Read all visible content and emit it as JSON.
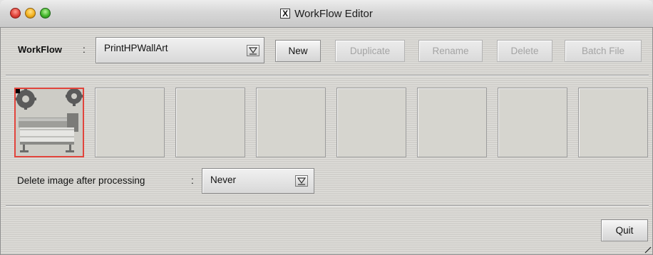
{
  "window": {
    "title": "WorkFlow Editor"
  },
  "workflow": {
    "label": "WorkFlow",
    "colon": ":",
    "selected": "PrintHPWallArt"
  },
  "buttons": {
    "new": "New",
    "duplicate": "Duplicate",
    "rename": "Rename",
    "delete": "Delete",
    "batch_file": "Batch File",
    "quit": "Quit"
  },
  "button_states": {
    "new": "enabled",
    "duplicate": "disabled",
    "rename": "disabled",
    "delete": "disabled",
    "batch_file": "disabled",
    "quit": "enabled"
  },
  "thumbnails": [
    {
      "selected": true,
      "content": "printer-image"
    },
    {
      "selected": false,
      "content": ""
    },
    {
      "selected": false,
      "content": ""
    },
    {
      "selected": false,
      "content": ""
    },
    {
      "selected": false,
      "content": ""
    },
    {
      "selected": false,
      "content": ""
    },
    {
      "selected": false,
      "content": ""
    },
    {
      "selected": false,
      "content": ""
    }
  ],
  "delete_option": {
    "label": "Delete image after processing",
    "colon": ":",
    "selected": "Never"
  },
  "colors": {
    "selection_border": "#e2443c",
    "disabled_text": "#a4a4a4"
  }
}
